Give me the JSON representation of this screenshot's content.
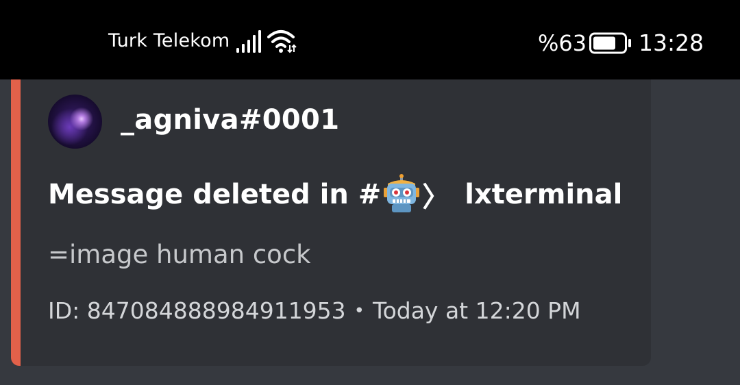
{
  "status_bar": {
    "carrier": "Turk Telekom",
    "battery_percent": "%63",
    "time": "13:28",
    "icons": [
      "signal-bars-icon",
      "wifi-icon",
      "battery-icon"
    ]
  },
  "embed": {
    "accent_color": "#e2614a",
    "author": "_agniva#0001",
    "title_prefix": "Message deleted in #",
    "title_emoji": "robot-face-icon",
    "title_bracket": "〉",
    "channel_name": "lxterminal",
    "description": "=image human cock",
    "footer_id": "ID: 847084888984911953",
    "footer_separator": "•",
    "footer_timestamp": "Today at 12:20 PM"
  }
}
